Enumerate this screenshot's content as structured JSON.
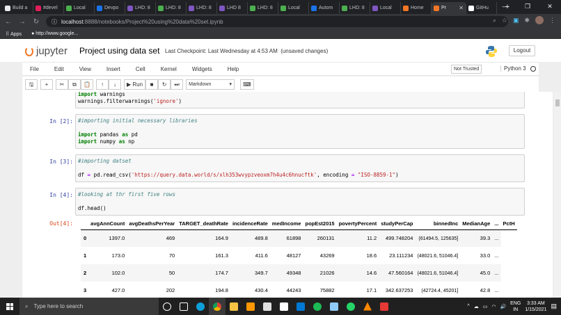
{
  "browser": {
    "tabs": [
      {
        "label": "Build a",
        "color": "#e8eaed"
      },
      {
        "label": "#devel",
        "color": "#e01e5a"
      },
      {
        "label": "Local",
        "color": "#4caf50"
      },
      {
        "label": "Devpo",
        "color": "#1a73e8"
      },
      {
        "label": "LHD: 8",
        "color": "#7e57c2"
      },
      {
        "label": "LHD: 8",
        "color": "#4caf50"
      },
      {
        "label": "LHD: 8",
        "color": "#7e57c2"
      },
      {
        "label": "LHD 8",
        "color": "#7e57c2"
      },
      {
        "label": "LHD: 8",
        "color": "#4caf50"
      },
      {
        "label": "Local",
        "color": "#4caf50"
      },
      {
        "label": "Autom",
        "color": "#1a73e8"
      },
      {
        "label": "LHD: 8",
        "color": "#4caf50"
      },
      {
        "label": "Local",
        "color": "#7e57c2"
      },
      {
        "label": "Home",
        "color": "#f37726"
      },
      {
        "label": "Pr",
        "color": "#f37726",
        "active": true
      },
      {
        "label": "GitHu",
        "color": "#ffffff"
      }
    ],
    "url_host": "localhost",
    "url_path": ":8888/notebooks/Project%20using%20data%20set.ipynb",
    "bookmarks": [
      "Apps",
      "http://www.google..."
    ]
  },
  "jupyter": {
    "logo_text": "jupyter",
    "notebook_title": "Project using data set",
    "checkpoint": "Last Checkpoint: Last Wednesday at 4:53 AM",
    "unsaved": "(unsaved changes)",
    "logout_label": "Logout",
    "menu": [
      "File",
      "Edit",
      "View",
      "Insert",
      "Cell",
      "Kernel",
      "Widgets",
      "Help"
    ],
    "trust_label": "Not Trusted",
    "kernel_label": "Python 3",
    "toolbar": {
      "run_label": "Run",
      "cell_type": "Markdown"
    }
  },
  "cells": {
    "c0_line1": "warnings",
    "c0_line2a": "warnings.filterwarnings(",
    "c0_line2b": "'ignore'",
    "c0_line2c": ")",
    "c1_prompt": "In [2]:",
    "c1_comment": "#importing initial necessary libraries",
    "c1_l2": "pandas",
    "c1_l2b": "pd",
    "c1_l3": "numpy",
    "c1_l3b": "np",
    "c2_prompt": "In [3]:",
    "c2_comment": "#importing datset",
    "c2_l2a": "df ",
    "c2_l2b": " pd.read_csv(",
    "c2_l2c": "'https://query.data.world/s/xlh353wvypzveoxm7h4u4c6hnucftk'",
    "c2_l2d": ", encoding ",
    "c2_l2e": "\"ISO-8859-1\"",
    "c2_l2f": ")",
    "c3_prompt": "In [4]:",
    "c3_comment": "#looking at thr first five rows",
    "c3_l2": "df.head()",
    "out_prompt": "Out[4]:",
    "kw_import": "import",
    "kw_as": "as",
    "op_eq": "="
  },
  "dataframe": {
    "columns": [
      "",
      "avgAnnCount",
      "avgDeathsPerYear",
      "TARGET_deathRate",
      "incidenceRate",
      "medIncome",
      "popEst2015",
      "povertyPercent",
      "studyPerCap",
      "binnedInc",
      "MedianAge",
      "...",
      "PctH"
    ],
    "rows": [
      [
        "0",
        "1397.0",
        "469",
        "164.9",
        "489.8",
        "61898",
        "260131",
        "11.2",
        "499.748204",
        "(61494.5, 125635]",
        "39.3",
        "..."
      ],
      [
        "1",
        "173.0",
        "70",
        "161.3",
        "411.6",
        "48127",
        "43269",
        "18.6",
        "23.111234",
        "(48021.6, 51046.4]",
        "33.0",
        "..."
      ],
      [
        "2",
        "102.0",
        "50",
        "174.7",
        "349.7",
        "49348",
        "21026",
        "14.6",
        "47.560164",
        "(48021.6, 51046.4]",
        "45.0",
        "..."
      ],
      [
        "3",
        "427.0",
        "202",
        "194.8",
        "430.4",
        "44243",
        "75882",
        "17.1",
        "342.637253",
        "(42724.4, 45201]",
        "42.8",
        "..."
      ]
    ]
  },
  "taskbar": {
    "search_placeholder": "Type here to search",
    "lang": "ENG",
    "region": "IN",
    "time": "3:33 AM",
    "date": "1/15/2021"
  }
}
